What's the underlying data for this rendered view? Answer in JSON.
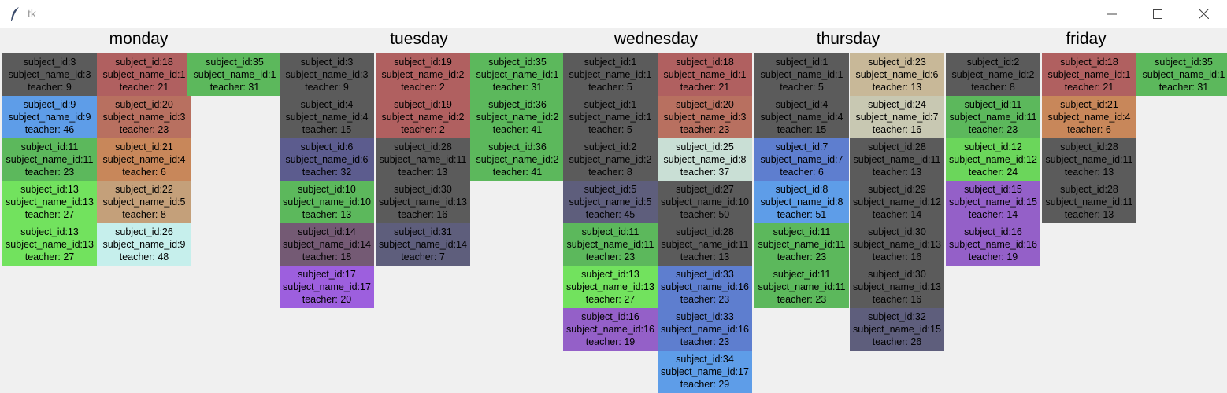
{
  "window": {
    "title": "tk",
    "icon": "feather-icon",
    "controls": [
      "minimize-icon",
      "maximize-icon",
      "close-icon"
    ]
  },
  "days": [
    "monday",
    "tuesday",
    "wednesday",
    "thursday",
    "friday"
  ],
  "labels": {
    "subject": "subject_id:",
    "subject_name": "subject_name_id:",
    "teacher": "teacher: "
  },
  "colors": {
    "dark": "#5b5b5b",
    "red": "#b06060",
    "green": "#5cb85c",
    "blue": "#5e9de8",
    "orange": "#c8875a",
    "tan": "#c4a07a",
    "light_green": "#72e25e",
    "lighter_green": "#6bd65b",
    "cyan": "#c6efec",
    "indigo": "#5c5c8e",
    "purple": "#9d5fde",
    "mauve": "#745a74",
    "slate": "#5e5e7c",
    "steel_blue": "#5e7ecf",
    "mint": "#c9dfd5",
    "beige": "#c8b898",
    "pale_gray": "#c8c8b2",
    "orchid": "#9460c8",
    "sienna": "#b87060"
  },
  "columns": [
    [
      {
        "s": "3",
        "n": "3",
        "t": "9",
        "c": "dark"
      },
      {
        "s": "9",
        "n": "9",
        "t": "46",
        "c": "blue"
      },
      {
        "s": "11",
        "n": "11",
        "t": "23",
        "c": "green"
      },
      {
        "s": "13",
        "n": "13",
        "t": "27",
        "c": "light_green"
      },
      {
        "s": "13",
        "n": "13",
        "t": "27",
        "c": "light_green"
      }
    ],
    [
      {
        "s": "18",
        "n": "1",
        "t": "21",
        "c": "red"
      },
      {
        "s": "20",
        "n": "3",
        "t": "23",
        "c": "sienna"
      },
      {
        "s": "21",
        "n": "4",
        "t": "6",
        "c": "orange"
      },
      {
        "s": "22",
        "n": "5",
        "t": "8",
        "c": "tan"
      },
      {
        "s": "26",
        "n": "9",
        "t": "48",
        "c": "cyan"
      }
    ],
    [
      {
        "s": "35",
        "n": "1",
        "t": "31",
        "c": "green"
      }
    ],
    [
      {
        "s": "3",
        "n": "3",
        "t": "9",
        "c": "dark"
      },
      {
        "s": "4",
        "n": "4",
        "t": "15",
        "c": "dark"
      },
      {
        "s": "6",
        "n": "6",
        "t": "32",
        "c": "indigo"
      },
      {
        "s": "10",
        "n": "10",
        "t": "13",
        "c": "green"
      },
      {
        "s": "14",
        "n": "14",
        "t": "18",
        "c": "mauve"
      },
      {
        "s": "17",
        "n": "17",
        "t": "20",
        "c": "purple"
      }
    ],
    [
      {
        "s": "19",
        "n": "2",
        "t": "2",
        "c": "red"
      },
      {
        "s": "19",
        "n": "2",
        "t": "2",
        "c": "red"
      },
      {
        "s": "28",
        "n": "11",
        "t": "13",
        "c": "dark"
      },
      {
        "s": "30",
        "n": "13",
        "t": "16",
        "c": "dark"
      },
      {
        "s": "31",
        "n": "14",
        "t": "7",
        "c": "slate"
      }
    ],
    [
      {
        "s": "35",
        "n": "1",
        "t": "31",
        "c": "green"
      },
      {
        "s": "36",
        "n": "2",
        "t": "41",
        "c": "green"
      },
      {
        "s": "36",
        "n": "2",
        "t": "41",
        "c": "green"
      }
    ],
    [
      {
        "s": "1",
        "n": "1",
        "t": "5",
        "c": "dark"
      },
      {
        "s": "1",
        "n": "1",
        "t": "5",
        "c": "dark"
      },
      {
        "s": "2",
        "n": "2",
        "t": "8",
        "c": "dark"
      },
      {
        "s": "5",
        "n": "5",
        "t": "45",
        "c": "slate"
      },
      {
        "s": "11",
        "n": "11",
        "t": "23",
        "c": "green"
      },
      {
        "s": "13",
        "n": "13",
        "t": "27",
        "c": "light_green"
      },
      {
        "s": "16",
        "n": "16",
        "t": "19",
        "c": "orchid"
      }
    ],
    [
      {
        "s": "18",
        "n": "1",
        "t": "21",
        "c": "red"
      },
      {
        "s": "20",
        "n": "3",
        "t": "23",
        "c": "sienna"
      },
      {
        "s": "25",
        "n": "8",
        "t": "37",
        "c": "mint"
      },
      {
        "s": "27",
        "n": "10",
        "t": "50",
        "c": "dark"
      },
      {
        "s": "28",
        "n": "11",
        "t": "13",
        "c": "dark"
      },
      {
        "s": "33",
        "n": "16",
        "t": "23",
        "c": "steel_blue"
      },
      {
        "s": "33",
        "n": "16",
        "t": "23",
        "c": "steel_blue"
      },
      {
        "s": "34",
        "n": "17",
        "t": "29",
        "c": "blue"
      }
    ],
    [
      {
        "s": "1",
        "n": "1",
        "t": "5",
        "c": "dark"
      },
      {
        "s": "4",
        "n": "4",
        "t": "15",
        "c": "dark"
      },
      {
        "s": "7",
        "n": "7",
        "t": "6",
        "c": "steel_blue"
      },
      {
        "s": "8",
        "n": "8",
        "t": "51",
        "c": "blue"
      },
      {
        "s": "11",
        "n": "11",
        "t": "23",
        "c": "green"
      },
      {
        "s": "11",
        "n": "11",
        "t": "23",
        "c": "green"
      }
    ],
    [
      {
        "s": "23",
        "n": "6",
        "t": "13",
        "c": "beige"
      },
      {
        "s": "24",
        "n": "7",
        "t": "16",
        "c": "pale_gray"
      },
      {
        "s": "28",
        "n": "11",
        "t": "13",
        "c": "dark"
      },
      {
        "s": "29",
        "n": "12",
        "t": "14",
        "c": "dark"
      },
      {
        "s": "30",
        "n": "13",
        "t": "16",
        "c": "dark"
      },
      {
        "s": "30",
        "n": "13",
        "t": "16",
        "c": "dark"
      },
      {
        "s": "32",
        "n": "15",
        "t": "26",
        "c": "slate"
      }
    ],
    [
      {
        "s": "2",
        "n": "2",
        "t": "8",
        "c": "dark"
      },
      {
        "s": "11",
        "n": "11",
        "t": "23",
        "c": "green"
      },
      {
        "s": "12",
        "n": "12",
        "t": "24",
        "c": "lighter_green"
      },
      {
        "s": "15",
        "n": "15",
        "t": "14",
        "c": "orchid"
      },
      {
        "s": "16",
        "n": "16",
        "t": "19",
        "c": "orchid"
      }
    ],
    [
      {
        "s": "18",
        "n": "1",
        "t": "21",
        "c": "red"
      },
      {
        "s": "21",
        "n": "4",
        "t": "6",
        "c": "orange"
      },
      {
        "s": "28",
        "n": "11",
        "t": "13",
        "c": "dark"
      },
      {
        "s": "28",
        "n": "11",
        "t": "13",
        "c": "dark"
      }
    ],
    [
      {
        "s": "35",
        "n": "1",
        "t": "31",
        "c": "green"
      }
    ]
  ]
}
